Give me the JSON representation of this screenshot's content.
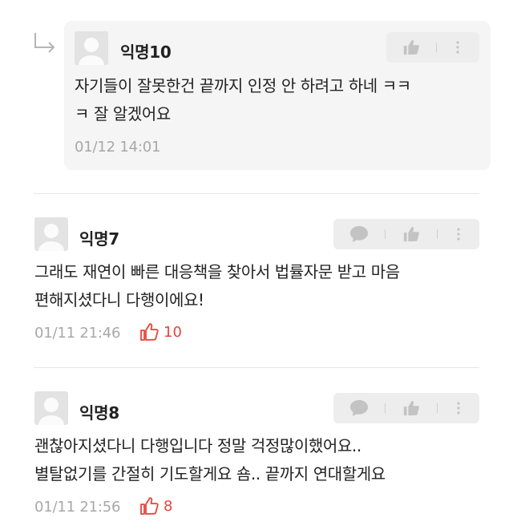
{
  "comments": [
    {
      "nickname": "익명10",
      "text_lines": [
        "자기들이 잘못한건 끝까지 인정 안 하려고 하네 ㅋㅋ",
        "ㅋ 잘 알겠어요"
      ],
      "timestamp": "01/12 14:01",
      "is_reply": true
    },
    {
      "nickname": "익명7",
      "text_lines": [
        "그래도 재연이 빠른 대응책을 찾아서 법률자문 받고 마음",
        "편해지셨다니 다행이에요!"
      ],
      "timestamp": "01/11 21:46",
      "like_count": "10"
    },
    {
      "nickname": "익명8",
      "text_lines": [
        "괜찮아지셨다니 다행입니다 정말 걱정많이했어요..",
        "별탈없기를 간절히 기도할게요 숌.. 끝까지 연대할게요"
      ],
      "timestamp": "01/11 21:56",
      "like_count": "8"
    }
  ],
  "icons": {
    "reply_arrow": "reply-arrow-icon",
    "comment": "comment-bubble-icon",
    "like": "thumbs-up-icon",
    "more": "more-vertical-icon"
  },
  "colors": {
    "like_accent": "#e5443a",
    "reply_background": "#f5f5f5",
    "meta_text": "#a8a8a8"
  }
}
